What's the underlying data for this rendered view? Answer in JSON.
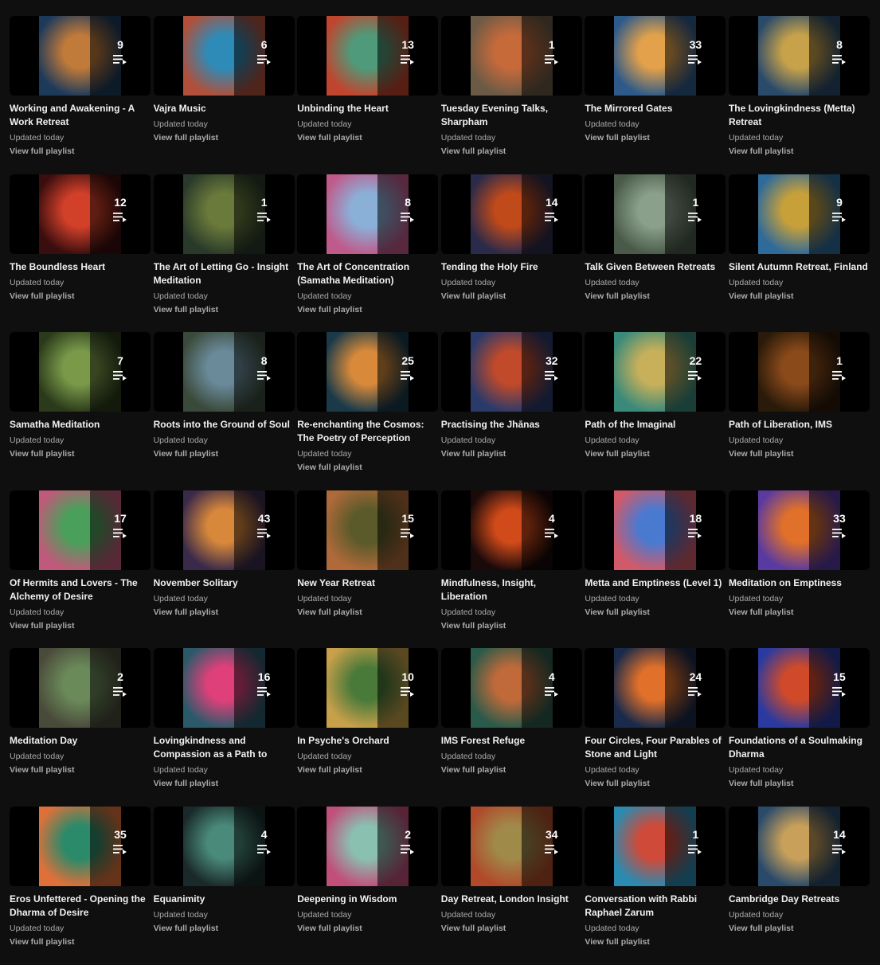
{
  "common": {
    "updated": "Updated today",
    "view_full": "View full playlist"
  },
  "playlists": [
    {
      "title": "Working and Awakening - A Work Retreat",
      "count": "9",
      "colors": [
        "#c07a3a",
        "#1e3a5a"
      ]
    },
    {
      "title": "Vajra Music",
      "count": "6",
      "colors": [
        "#2e8bb8",
        "#b0503a"
      ]
    },
    {
      "title": "Unbinding the Heart",
      "count": "13",
      "colors": [
        "#4f9a7a",
        "#c0452e"
      ]
    },
    {
      "title": "Tuesday Evening Talks, Sharpham",
      "count": "1",
      "colors": [
        "#c76a3a",
        "#6a5a46"
      ]
    },
    {
      "title": "The Mirrored Gates",
      "count": "33",
      "colors": [
        "#e2a14a",
        "#2e5a8a"
      ]
    },
    {
      "title": "The Lovingkindness (Metta) Retreat",
      "count": "8",
      "colors": [
        "#c8a24a",
        "#2a4a6a"
      ]
    },
    {
      "title": "The Boundless Heart",
      "count": "12",
      "colors": [
        "#d2402a",
        "#3a0e0e"
      ]
    },
    {
      "title": "The Art of Letting Go - Insight Meditation",
      "count": "1",
      "colors": [
        "#6a7a3a",
        "#2a3a2a"
      ]
    },
    {
      "title": "The Art of Concentration (Samatha Meditation)",
      "count": "8",
      "colors": [
        "#8ab0d8",
        "#c05a8a"
      ]
    },
    {
      "title": "Tending the Holy Fire",
      "count": "14",
      "colors": [
        "#c04a1a",
        "#2a2a4a"
      ]
    },
    {
      "title": "Talk Given Between Retreats",
      "count": "1",
      "colors": [
        "#8aa08a",
        "#4a5a4a"
      ]
    },
    {
      "title": "Silent Autumn Retreat, Finland",
      "count": "9",
      "colors": [
        "#c8a03a",
        "#2e6a9a"
      ]
    },
    {
      "title": "Samatha Meditation",
      "count": "7",
      "colors": [
        "#7a9a4a",
        "#2a3a1a"
      ]
    },
    {
      "title": "Roots into the Ground of Soul",
      "count": "8",
      "colors": [
        "#6a8a9a",
        "#3a4a3a"
      ]
    },
    {
      "title": "Re-enchanting the Cosmos: The Poetry of Perception",
      "count": "25",
      "colors": [
        "#d88a3a",
        "#1a3a4a"
      ]
    },
    {
      "title": "Practising the Jhānas",
      "count": "32",
      "colors": [
        "#c04a2a",
        "#2a3a6a"
      ]
    },
    {
      "title": "Path of the Imaginal",
      "count": "22",
      "colors": [
        "#c8b05a",
        "#3a8a7a"
      ]
    },
    {
      "title": "Path of Liberation, IMS",
      "count": "1",
      "colors": [
        "#8a4a1a",
        "#2a1a0a"
      ]
    },
    {
      "title": "Of Hermits and Lovers - The Alchemy of Desire",
      "count": "17",
      "colors": [
        "#4aa05a",
        "#c05a7a"
      ]
    },
    {
      "title": "November Solitary",
      "count": "43",
      "colors": [
        "#d8883a",
        "#3a2a4a"
      ]
    },
    {
      "title": "New Year Retreat",
      "count": "15",
      "colors": [
        "#5a5a2a",
        "#b06a3a"
      ]
    },
    {
      "title": "Mindfulness, Insight, Liberation",
      "count": "4",
      "colors": [
        "#d04a1a",
        "#1a0a0a"
      ]
    },
    {
      "title": "Metta and Emptiness (Level 1)",
      "count": "18",
      "colors": [
        "#4a7ad0",
        "#d05a6a"
      ]
    },
    {
      "title": "Meditation on Emptiness",
      "count": "33",
      "colors": [
        "#e0702a",
        "#5a3aa0"
      ]
    },
    {
      "title": "Meditation Day",
      "count": "2",
      "colors": [
        "#6a8a5a",
        "#4a4a3a"
      ]
    },
    {
      "title": "Lovingkindness and Compassion as a Path to Awakening",
      "count": "16",
      "colors": [
        "#e0407a",
        "#2a5a6a"
      ]
    },
    {
      "title": "In Psyche's Orchard",
      "count": "10",
      "colors": [
        "#4a7a3a",
        "#c8a04a"
      ]
    },
    {
      "title": "IMS Forest Refuge",
      "count": "4",
      "colors": [
        "#c06a3a",
        "#2a5a4a"
      ]
    },
    {
      "title": "Four Circles, Four Parables of Stone and Light",
      "count": "24",
      "colors": [
        "#e0702a",
        "#1a2a4a"
      ]
    },
    {
      "title": "Foundations of a Soulmaking Dharma",
      "count": "15",
      "colors": [
        "#d04a2a",
        "#2a3aa0"
      ]
    },
    {
      "title": "Eros Unfettered - Opening the Dharma of Desire",
      "count": "35",
      "colors": [
        "#2a8a6a",
        "#e0703a"
      ]
    },
    {
      "title": "Equanimity",
      "count": "4",
      "colors": [
        "#4a8a7a",
        "#1a2a2a"
      ]
    },
    {
      "title": "Deepening in Wisdom",
      "count": "2",
      "colors": [
        "#8ac0b0",
        "#c0507a"
      ]
    },
    {
      "title": "Day Retreat, London Insight",
      "count": "34",
      "colors": [
        "#a08a4a",
        "#b04a2a"
      ]
    },
    {
      "title": "Conversation with Rabbi Raphael Zarum",
      "count": "1",
      "colors": [
        "#d04a3a",
        "#2a8ab0"
      ]
    },
    {
      "title": "Cambridge Day Retreats",
      "count": "14",
      "colors": [
        "#c8a05a",
        "#2a4a6a"
      ]
    }
  ]
}
